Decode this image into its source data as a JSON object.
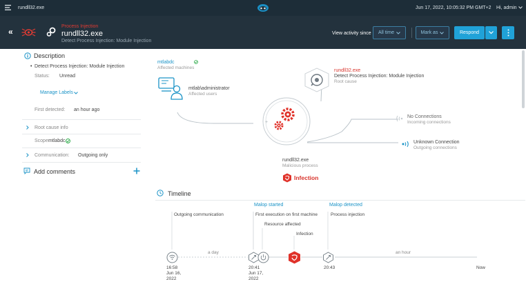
{
  "topbar": {
    "file": "rundll32.exe",
    "datetime": "Jun 17, 2022, 10:05:32 PM GMT+2",
    "user": "Hi, admin"
  },
  "header": {
    "category": "Process Injection",
    "title": "rundll32.exe",
    "subtitle": "Detect Process Injection: Module Injection",
    "view_activity": "View activity since",
    "all_time": "All time",
    "mark_as": "Mark as",
    "respond": "Respond"
  },
  "description": {
    "heading": "Description",
    "bullet": "Detect Process Injection: Module Injection",
    "status_label": "Status:",
    "status_value": "Unread",
    "manage_labels": "Manage Labels",
    "first_detected_label": "First detected:",
    "first_detected_value": "an hour ago",
    "root_cause_info": "Root cause info",
    "scope_label": "Scope:",
    "scope_value": "mtlabdc",
    "communication_label": "Communication:",
    "communication_value": "Outgoing only"
  },
  "comments": {
    "heading": "Add comments"
  },
  "graph": {
    "machine_name": "mtlabdc",
    "machine_caption": "Affected machines",
    "user_name": "mtlab\\administrator",
    "user_caption": "Affected users",
    "root_name": "rundll32.exe",
    "root_desc": "Detect Process Injection: Module Injection",
    "root_caption": "Root cause",
    "incoming_name": "No Connections",
    "incoming_caption": "Incoming connections",
    "outgoing_name": "Unknown Connection",
    "outgoing_caption": "Outgoing connections",
    "process_name": "rundll32.exe",
    "process_caption": "Malicious process",
    "infection": "Infection"
  },
  "timeline": {
    "heading": "Timeline",
    "malop_started": "Malop started",
    "malop_detected": "Malop detected",
    "outgoing": "Outgoing communication",
    "first_exec": "First execution on first machine",
    "resource": "Resource affected",
    "infection": "Infection",
    "process_injection": "Process injection",
    "gap1": "a day",
    "gap2": "an hour",
    "t1_time": "16:58",
    "t1_date1": "Jun 16,",
    "t1_date2": "2022",
    "t2_time": "20:41",
    "t2_date1": "Jun 17,",
    "t2_date2": "2022",
    "t3_time": "20:43",
    "now": "Now"
  },
  "colors": {
    "accent": "#1a93c7",
    "danger": "#d8332b",
    "header": "#23323d"
  }
}
